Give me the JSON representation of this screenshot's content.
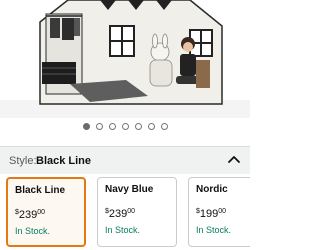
{
  "carousel": {
    "image_alt": "Playhouse tent with child, toy rabbit and rack",
    "dot_count": 7,
    "active_index": 0
  },
  "style_selector": {
    "label": "Style:",
    "selected": "Black Line",
    "chevron": "chevron-up-icon"
  },
  "options": [
    {
      "name": "Black Line",
      "currency": "$",
      "dollars": "239",
      "cents": "00",
      "availability": "In Stock.",
      "selected": true
    },
    {
      "name": "Navy Blue",
      "currency": "$",
      "dollars": "239",
      "cents": "00",
      "availability": "In Stock.",
      "selected": false
    },
    {
      "name": "Nordic",
      "currency": "$",
      "dollars": "199",
      "cents": "00",
      "availability": "In Stock.",
      "selected": false
    }
  ],
  "colors": {
    "selected_border": "#e47911",
    "stock_green": "#067d62",
    "dot_active": "#6b6b6b"
  }
}
